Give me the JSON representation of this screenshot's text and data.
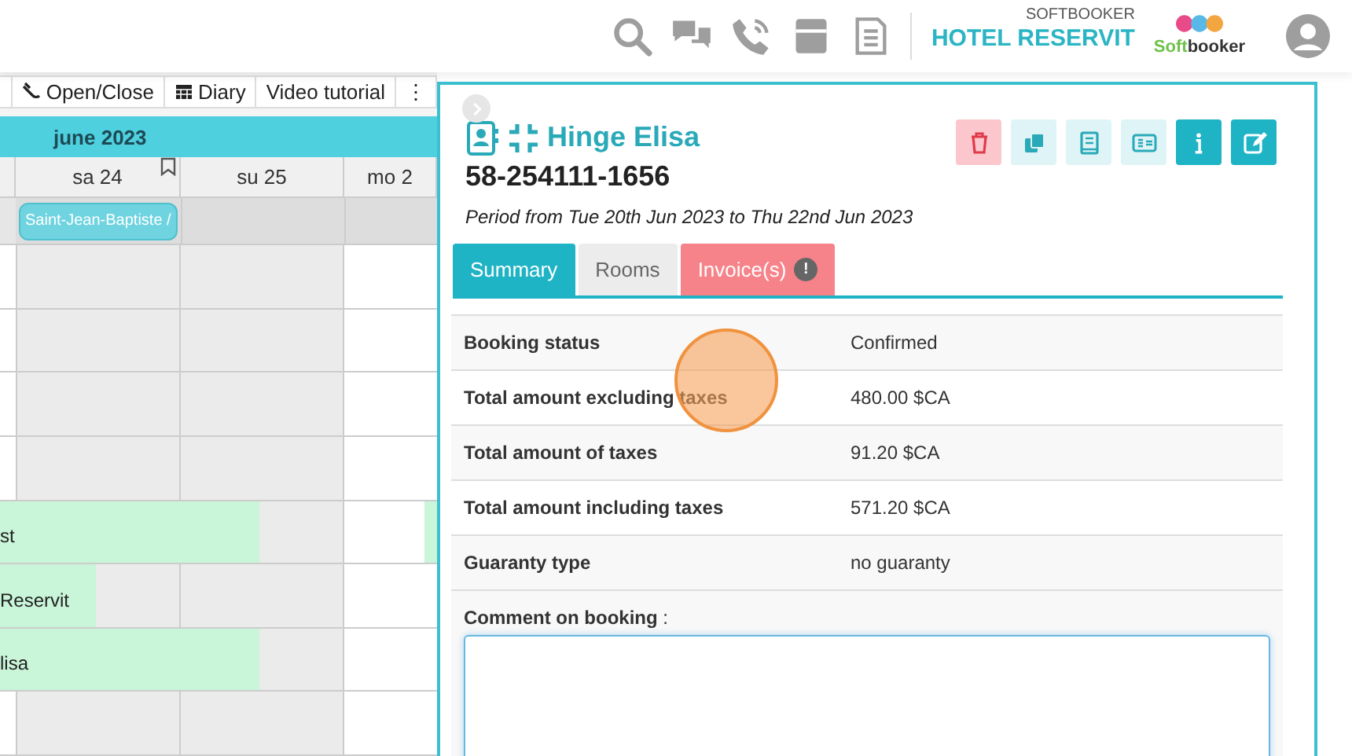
{
  "header": {
    "brand_small": "SOFTBOOKER",
    "brand": "HOTEL RESERVIT",
    "logo": {
      "part_1": "Soft",
      "part_2": "booker"
    }
  },
  "toolbar": [
    {
      "label": "Open/Close"
    },
    {
      "label": "Diary"
    },
    {
      "label": "Video tutorial"
    },
    {
      "label": "⋮"
    }
  ],
  "calendar": {
    "month": "june 2023",
    "days": [
      {
        "label": "sa 24",
        "bookmarked": true
      },
      {
        "label": "su 25",
        "bookmarked": false
      },
      {
        "label": "mo 2",
        "bookmarked": false
      }
    ],
    "holiday": "Saint-Jean-Baptiste /",
    "rows": [
      {},
      {},
      {},
      {},
      {
        "booking": {
          "label": "st"
        }
      },
      {
        "booking": {
          "label": "Reservit"
        }
      },
      {
        "booking": {
          "label": "lisa"
        }
      },
      {}
    ]
  },
  "panel": {
    "guest": "Hinge Elisa",
    "number": "58-254111-1656",
    "period": "Period from Tue 20th Jun 2023 to Thu 22nd Jun 2023",
    "actions": [
      {
        "kind": "delete"
      },
      {
        "kind": "copy"
      },
      {
        "kind": "book"
      },
      {
        "kind": "card"
      },
      {
        "kind": "info"
      },
      {
        "kind": "edit"
      }
    ],
    "tabs": [
      {
        "label": "Summary",
        "selected": true
      },
      {
        "label": "Rooms",
        "selected": false
      },
      {
        "label": "Invoice(s)",
        "selected": false,
        "badge": "!"
      }
    ],
    "rows": [
      {
        "label": "Booking status",
        "value": "Confirmed"
      },
      {
        "label": "Total amount excluding taxes",
        "value": "480.00 $CA"
      },
      {
        "label": "Total amount of taxes",
        "value": "91.20 $CA"
      },
      {
        "label": "Total amount including taxes",
        "value": "571.20 $CA"
      },
      {
        "label": "Guaranty type",
        "value": "no guaranty"
      }
    ],
    "comment_label": "**Comment on booking** :"
  }
}
